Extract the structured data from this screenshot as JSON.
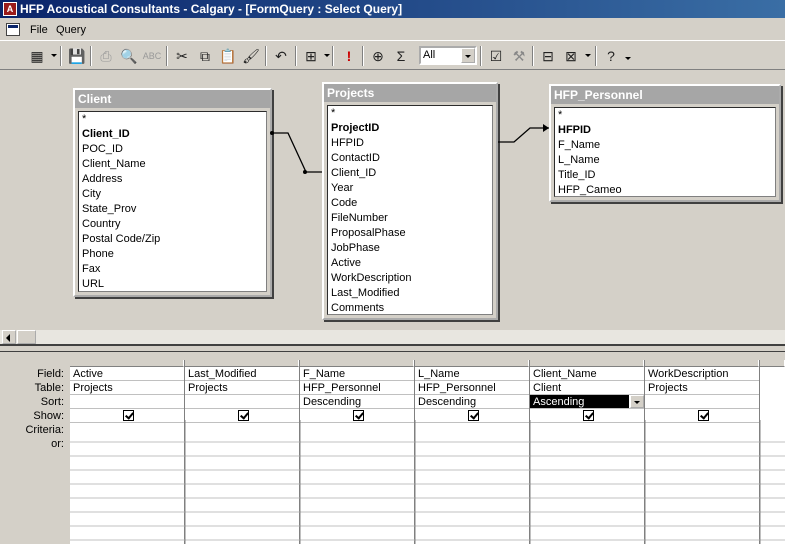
{
  "window": {
    "title": "HFP Acoustical Consultants - Calgary - [FormQuery : Select Query]"
  },
  "menu": {
    "file": "File",
    "query": "Query"
  },
  "toolbar": {
    "top_values": "All"
  },
  "tables": [
    {
      "name": "Client",
      "fields": [
        "*",
        "Client_ID",
        "POC_ID",
        "Client_Name",
        "Address",
        "City",
        "State_Prov",
        "Country",
        "Postal Code/Zip",
        "Phone",
        "Fax",
        "URL"
      ],
      "key": "Client_ID"
    },
    {
      "name": "Projects",
      "fields": [
        "*",
        "ProjectID",
        "HFPID",
        "ContactID",
        "Client_ID",
        "Year",
        "Code",
        "FileNumber",
        "ProposalPhase",
        "JobPhase",
        "Active",
        "WorkDescription",
        "Last_Modified",
        "Comments"
      ],
      "key": "ProjectID"
    },
    {
      "name": "HFP_Personnel",
      "fields": [
        "*",
        "HFPID",
        "F_Name",
        "L_Name",
        "Title_ID",
        "HFP_Cameo"
      ],
      "key": "HFPID"
    }
  ],
  "grid": {
    "row_labels": [
      "Field:",
      "Table:",
      "Sort:",
      "Show:",
      "Criteria:",
      "or:"
    ],
    "columns": [
      {
        "field": "Active",
        "table": "Projects",
        "sort": "",
        "show": true
      },
      {
        "field": "Last_Modified",
        "table": "Projects",
        "sort": "",
        "show": true
      },
      {
        "field": "F_Name",
        "table": "HFP_Personnel",
        "sort": "Descending",
        "show": true
      },
      {
        "field": "L_Name",
        "table": "HFP_Personnel",
        "sort": "Descending",
        "show": true
      },
      {
        "field": "Client_Name",
        "table": "Client",
        "sort": "Ascending",
        "show": true
      },
      {
        "field": "WorkDescription",
        "table": "Projects",
        "sort": "",
        "show": true
      }
    ]
  }
}
